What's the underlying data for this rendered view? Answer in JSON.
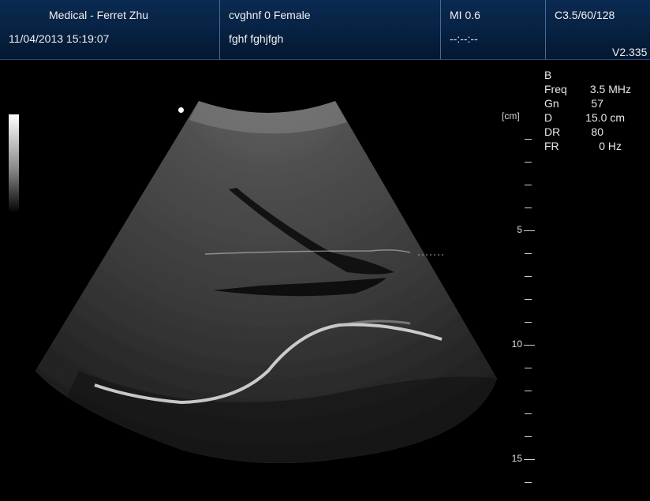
{
  "header": {
    "facility": "Medical - Ferret Zhu",
    "datetime": "11/04/2013 15:19:07",
    "patient_line1": "cvghnf 0 Female",
    "patient_line2": "fghf  fghjfgh",
    "mi": "MI 0.6",
    "ti": "--:--:--",
    "probe": "C3.5/60/128",
    "version": "V2.335"
  },
  "params": {
    "mode": "B",
    "rows": [
      {
        "key": "Freq",
        "value": "3.5 MHz"
      },
      {
        "key": "Gn",
        "value": "57"
      },
      {
        "key": "D",
        "value": "15.0 cm"
      },
      {
        "key": "DR",
        "value": "80"
      },
      {
        "key": "FR",
        "value": "0 Hz"
      }
    ]
  },
  "depth_scale": {
    "unit_label": "[cm]",
    "labels": [
      "5",
      "10",
      "15"
    ],
    "max_cm": 15.0
  },
  "colors": {
    "header_bg": "#06203f",
    "header_divider": "#4a6a98"
  }
}
